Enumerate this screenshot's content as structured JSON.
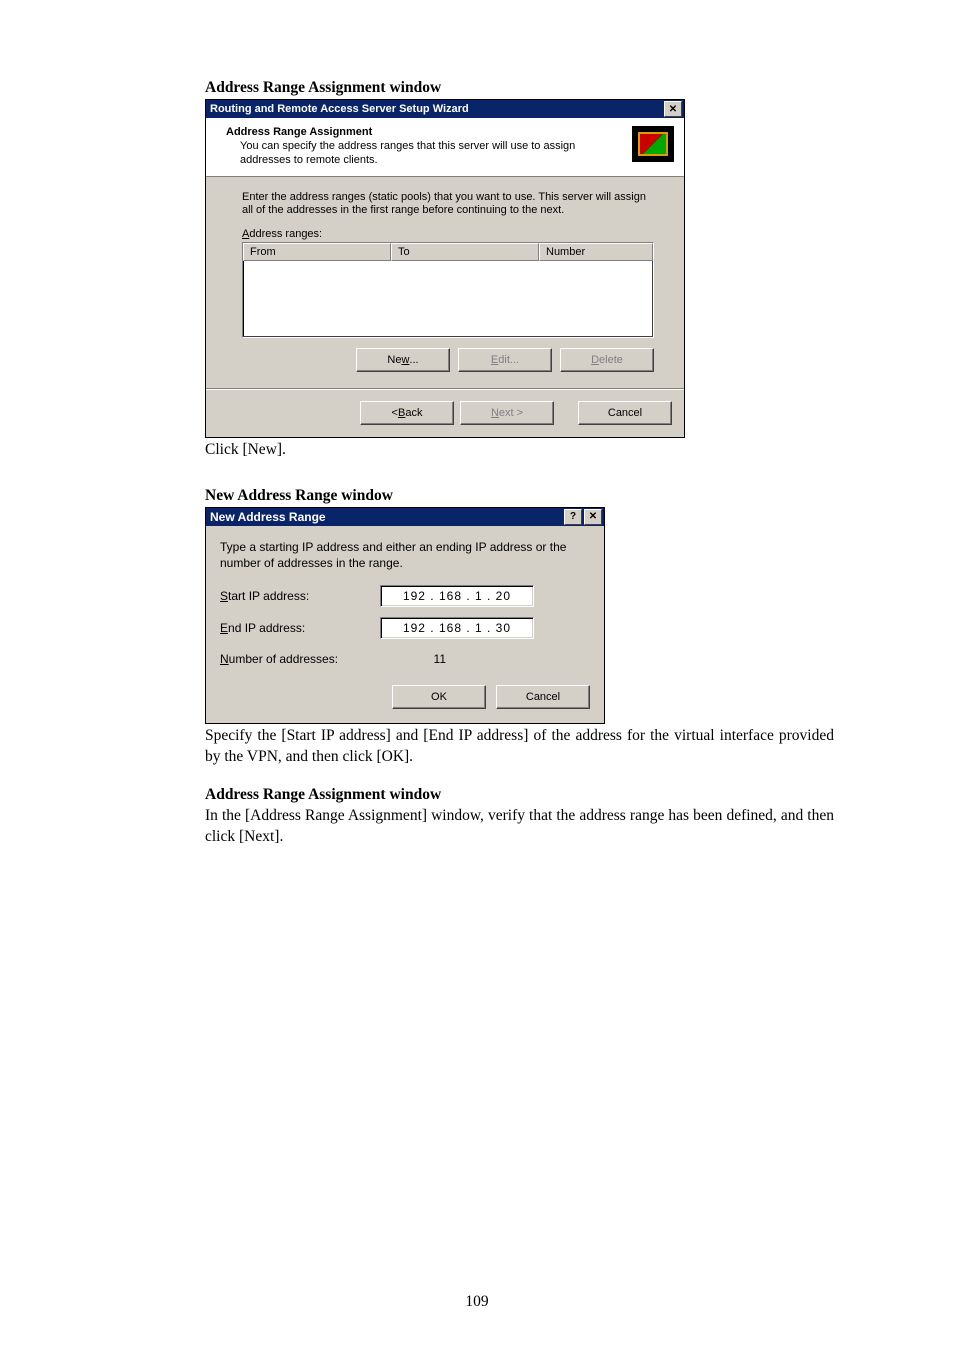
{
  "sections": {
    "caption1": "Address Range Assignment window",
    "caption2": "New Address Range window",
    "caption3": "Address Range Assignment window",
    "text1": "Click [New].",
    "text2": "Specify the [Start IP address] and [End IP address] of the address for the virtual interface provided by the VPN, and then click [OK].",
    "text3": "In the [Address Range Assignment] window, verify that the address range has been defined, and then click [Next]."
  },
  "wizard": {
    "title": "Routing and Remote Access Server Setup Wizard",
    "close_glyph": "✕",
    "header_title": "Address Range Assignment",
    "header_sub": "You can specify the address ranges that this server will use to assign addresses to remote clients.",
    "intro": "Enter the address ranges (static pools) that you want to use. This server will assign all of the addresses in the first range before continuing to the next.",
    "label_prefix": "A",
    "label_rest": "ddress ranges:",
    "cols": {
      "from": "From",
      "to": "To",
      "number": "Number"
    },
    "buttons": {
      "new_pre": "Ne",
      "new_u": "w",
      "new_post": "...",
      "edit_u": "E",
      "edit_post": "dit...",
      "delete_u": "D",
      "delete_post": "elete",
      "back": "< ",
      "back_u": "B",
      "back_post": "ack",
      "next_u": "N",
      "next_post": "ext >",
      "cancel": "Cancel"
    }
  },
  "newrange": {
    "title": "New Address Range",
    "help_glyph": "?",
    "close_glyph": "✕",
    "intro": "Type a starting IP address and either an ending IP address or the number of addresses in the range.",
    "labels": {
      "start_u": "S",
      "start_rest": "tart IP address:",
      "end_u": "E",
      "end_rest": "nd IP address:",
      "num_u": "N",
      "num_rest": "umber of addresses:"
    },
    "values": {
      "start_ip": "192 . 168 .  1  .  20",
      "end_ip": "192 . 168 .  1  .  30",
      "number": "11"
    },
    "buttons": {
      "ok": "OK",
      "cancel": "Cancel"
    }
  },
  "page_number": "109"
}
